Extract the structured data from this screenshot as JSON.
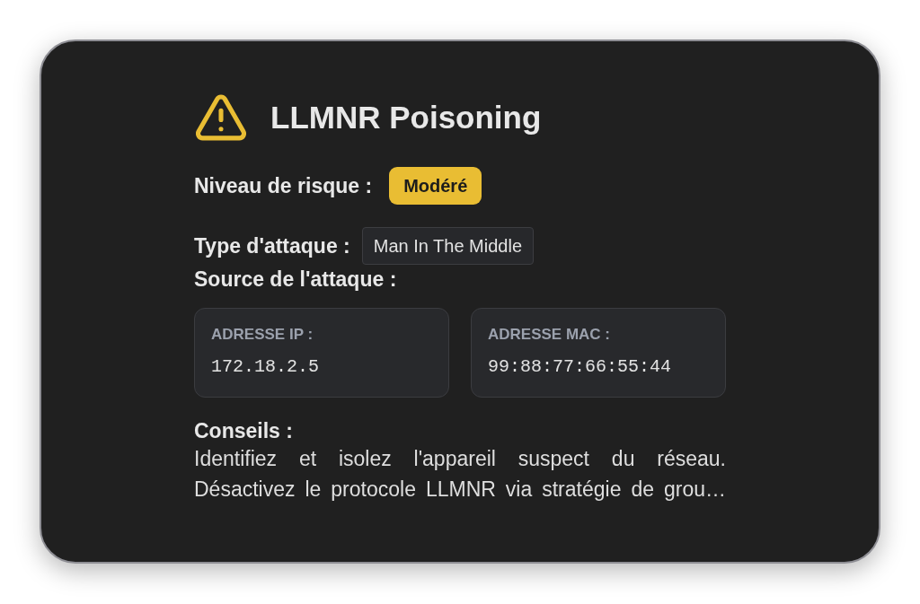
{
  "card": {
    "title": "LLMNR Poisoning",
    "risk": {
      "label": "Niveau de risque :",
      "value": "Modéré",
      "kind": "moderate"
    },
    "attack_type": {
      "label": "Type d'attaque :",
      "value": "Man In The Middle"
    },
    "source": {
      "label": "Source de l'attaque :",
      "fields": [
        {
          "label": "ADRESSE IP :",
          "value": "172.18.2.5"
        },
        {
          "label": "ADRESSE MAC :",
          "value": "99:88:77:66:55:44"
        }
      ]
    },
    "advice": {
      "label": "Conseils :",
      "text": "Identifiez et isolez l'appareil suspect du réseau. Désactivez le protocole LLMNR via stratégie de grou…"
    }
  }
}
